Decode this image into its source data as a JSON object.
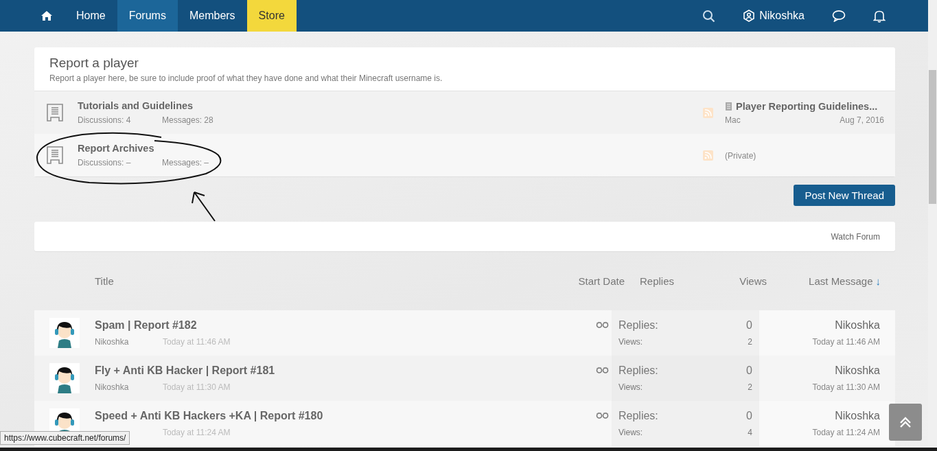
{
  "nav": {
    "items": [
      {
        "kind": "home",
        "selected": false
      },
      {
        "kind": "link",
        "label": "Home",
        "selected": false
      },
      {
        "kind": "link",
        "label": "Forums",
        "selected": true
      },
      {
        "kind": "link",
        "label": "Members",
        "selected": false
      },
      {
        "kind": "featured",
        "label": "Store",
        "selected": false
      }
    ],
    "user": "Nikoshka"
  },
  "forum": {
    "title": "Report a player",
    "description": "Report a player here, be sure to include proof of what they have done and what their Minecraft username is."
  },
  "subforums": [
    {
      "title": "Tutorials and Guidelines",
      "discussions": "Discussions: 4",
      "messages": "Messages: 28",
      "last_post": {
        "kind": "post",
        "title": "Player Reporting Guidelines...",
        "author": "Mac",
        "date": "Aug 7, 2016"
      }
    },
    {
      "title": "Report Archives",
      "discussions": "Discussions: –",
      "messages": "Messages: –",
      "last_post": {
        "kind": "private",
        "title": "(Private)"
      }
    }
  ],
  "post_button": "Post New Thread",
  "watch_forum": "Watch Forum",
  "columns": {
    "title": "Title",
    "start_date": "Start Date",
    "replies": "Replies",
    "views": "Views",
    "last_message": "Last Message",
    "sort_arrow": "↓"
  },
  "threads": [
    {
      "title": "Spam | Report #182",
      "author": "Nikoshka",
      "date": "Today at 11:46 AM",
      "replies_label": "Replies:",
      "replies": "0",
      "views_label": "Views:",
      "views": "2",
      "last_author": "Nikoshka",
      "last_date": "Today at 11:46 AM"
    },
    {
      "title": "Fly + Anti KB Hacker | Report #181",
      "author": "Nikoshka",
      "date": "Today at 11:30 AM",
      "replies_label": "Replies:",
      "replies": "0",
      "views_label": "Views:",
      "views": "2",
      "last_author": "Nikoshka",
      "last_date": "Today at 11:30 AM"
    },
    {
      "title": "Speed + Anti KB Hackers +KA | Report #180",
      "date": "Today at 11:24 AM",
      "replies_label": "Replies:",
      "replies": "0",
      "views_label": "Views:",
      "views": "4",
      "last_author": "Nikoshka",
      "last_date": "Today at 11:24 AM"
    }
  ],
  "status_url": "https://www.cubecraft.net/forums/"
}
